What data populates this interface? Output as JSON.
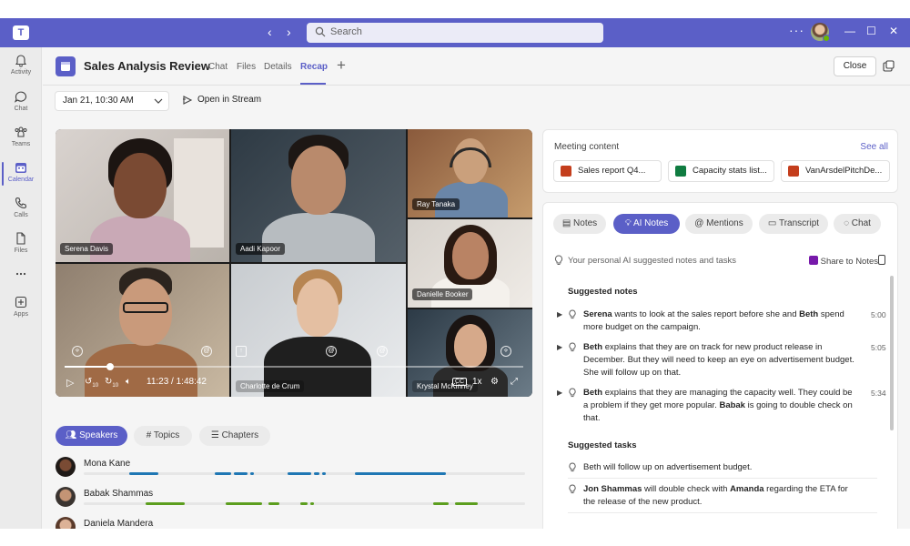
{
  "window": {
    "search_placeholder": "Search",
    "more": "···"
  },
  "rail": {
    "items": [
      {
        "label": "Activity",
        "icon": "bell-icon"
      },
      {
        "label": "Chat",
        "icon": "chat-icon"
      },
      {
        "label": "Teams",
        "icon": "teams-icon"
      },
      {
        "label": "Calendar",
        "icon": "calendar-icon"
      },
      {
        "label": "Calls",
        "icon": "phone-icon"
      },
      {
        "label": "Files",
        "icon": "file-icon"
      },
      {
        "label": "",
        "icon": "more-icon"
      },
      {
        "label": "Apps",
        "icon": "apps-icon"
      }
    ],
    "active": "Calendar"
  },
  "header": {
    "title": "Sales Analysis Review",
    "tabs": [
      "Chat",
      "Files",
      "Details",
      "Recap"
    ],
    "active_tab": "Recap",
    "close_label": "Close"
  },
  "subheader": {
    "date_value": "Jan 21, 10:30 AM",
    "open_stream_label": "Open in Stream"
  },
  "video": {
    "participants": [
      "Serena Davis",
      "Aadi Kapoor",
      "Ray Tanaka",
      "Danielle Booker",
      "Charlotte de Crum",
      "Krystal McKinney"
    ],
    "time": "11:23 / 1:48:42",
    "progress_fraction": 0.1,
    "speed": "1x",
    "skip_back": "10",
    "skip_forward": "10"
  },
  "speakers_panel": {
    "tabs": [
      "Speakers",
      "Topics",
      "Chapters"
    ],
    "active_tab": "Speakers",
    "speakers": [
      {
        "name": "Mona Kane",
        "color": "#1f77b4"
      },
      {
        "name": "Babak Shammas",
        "color": "#5c9e1e"
      },
      {
        "name": "Daniela Mandera",
        "color": "#8c2aa8"
      }
    ]
  },
  "meeting_content": {
    "title": "Meeting content",
    "see_all": "See all",
    "files": [
      {
        "name": "Sales report Q4...",
        "type": "powerpoint",
        "color": "#c43e1c"
      },
      {
        "name": "Capacity stats list...",
        "type": "excel",
        "color": "#107c41"
      },
      {
        "name": "VanArsdelPitchDe...",
        "type": "powerpoint",
        "color": "#c43e1c"
      }
    ]
  },
  "notes_panel": {
    "tabs": [
      "Notes",
      "AI Notes",
      "Mentions",
      "Transcript",
      "Chat"
    ],
    "active_tab": "AI Notes",
    "hint": "Your personal AI suggested notes and tasks",
    "share_label": "Share to Notes",
    "suggested_notes_title": "Suggested notes",
    "notes": [
      {
        "bold": "Serena",
        "text": " wants to look at the sales report before she and ",
        "bold2": "Beth",
        "text2": " spend more budget on the campaign.",
        "time": "5:00"
      },
      {
        "bold": "Beth",
        "text": " explains that they are on track for new product release in December. But they will need to keep an eye on advertisement budget. She will follow up on that.",
        "bold2": "",
        "text2": "",
        "time": "5:05"
      },
      {
        "bold": "Beth",
        "text": " explains that they are managing the capacity well. They could be a problem if they get more popular. ",
        "bold2": "Babak",
        "text2": " is going to double check on that.",
        "time": "5:34"
      }
    ],
    "suggested_tasks_title": "Suggested tasks",
    "tasks": [
      {
        "bold": "",
        "text": "Beth will follow up on advertisement budget.",
        "bold2": "",
        "text2": ""
      },
      {
        "bold": "Jon Shammas",
        "text": " will double check with ",
        "bold2": "Amanda",
        "text2": " regarding the ETA for the release of the new product."
      }
    ]
  },
  "colors": {
    "brand": "#5b5fc7",
    "rail_bg": "#ebebeb",
    "app_bg": "#f5f5f5"
  }
}
